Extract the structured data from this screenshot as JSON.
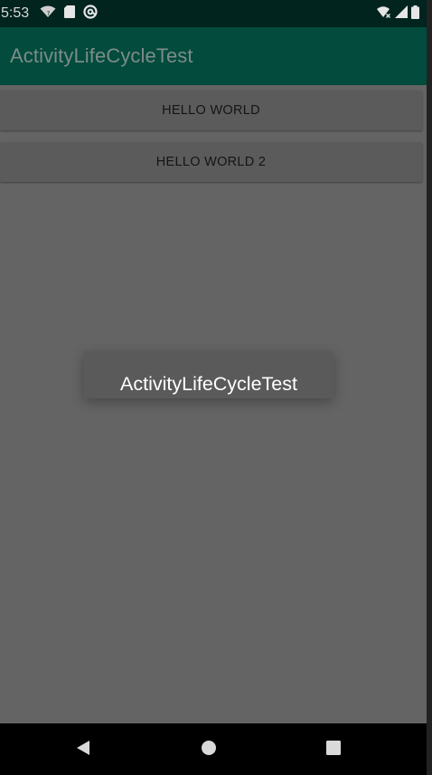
{
  "status_bar": {
    "time": "5:53",
    "left_icons": [
      "wifi-question-icon",
      "sd-card-icon",
      "sync-icon"
    ],
    "right_icons": [
      "wifi-x-icon",
      "cell-signal-icon",
      "battery-icon"
    ]
  },
  "app_bar": {
    "title": "ActivityLifeCycleTest"
  },
  "buttons": [
    {
      "label": "HELLO WORLD"
    },
    {
      "label": "HELLO WORLD 2"
    }
  ],
  "toast": {
    "text": "ActivityLifeCycleTest"
  },
  "nav_bar": {
    "icons": [
      "back-icon",
      "home-icon",
      "recents-icon"
    ]
  },
  "colors": {
    "status_bar": "#01241e",
    "app_bar": "#024b3d",
    "background": "#646464"
  }
}
